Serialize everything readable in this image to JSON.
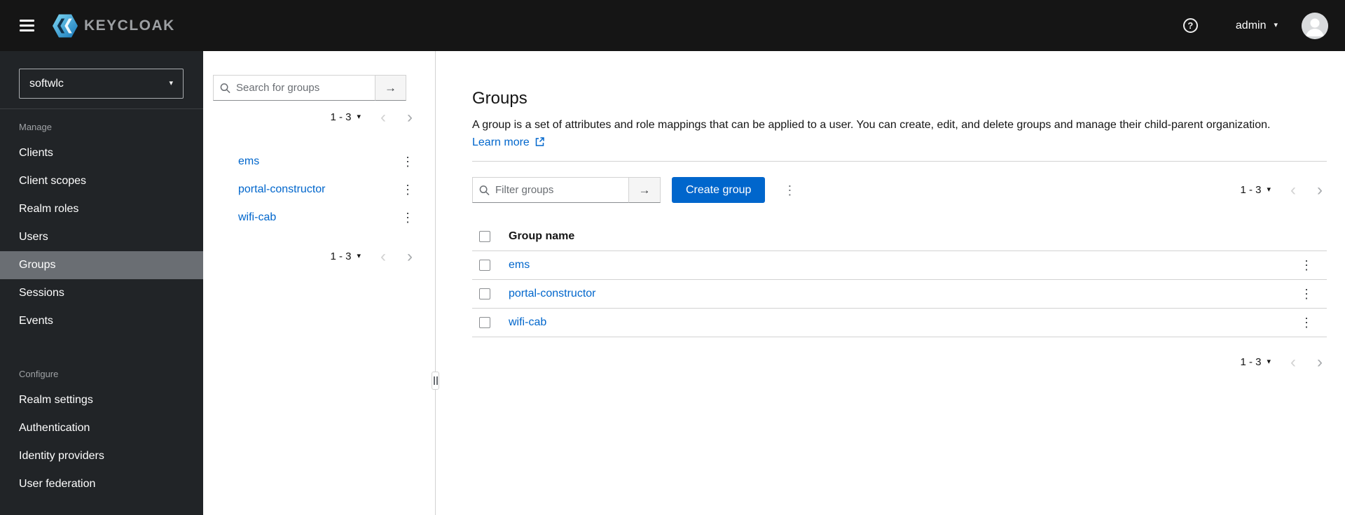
{
  "masthead": {
    "brand": "KEYCLOAK",
    "user": "admin"
  },
  "icons": {
    "help": "?",
    "caret_down": "▾",
    "arrow_right": "→",
    "kebab": "⋮",
    "chevron_left": "‹",
    "chevron_right": "›"
  },
  "sidebar": {
    "realm": "softwlc",
    "sections": [
      {
        "label": "Manage",
        "items": [
          {
            "label": "Clients"
          },
          {
            "label": "Client scopes"
          },
          {
            "label": "Realm roles"
          },
          {
            "label": "Users"
          },
          {
            "label": "Groups",
            "active": true
          },
          {
            "label": "Sessions"
          },
          {
            "label": "Events"
          }
        ]
      },
      {
        "label": "Configure",
        "items": [
          {
            "label": "Realm settings"
          },
          {
            "label": "Authentication"
          },
          {
            "label": "Identity providers"
          },
          {
            "label": "User federation"
          }
        ]
      }
    ]
  },
  "drawer": {
    "search_placeholder": "Search for groups",
    "groups": [
      "ems",
      "portal-constructor",
      "wifi-cab"
    ]
  },
  "pagination": {
    "range": "1 - 3"
  },
  "main": {
    "title": "Groups",
    "description": "A group is a set of attributes and role mappings that can be applied to a user. You can create, edit, and delete groups and manage their child-parent organization.",
    "learn_more": "Learn more",
    "filter_placeholder": "Filter groups",
    "create_label": "Create group",
    "table": {
      "header": "Group name",
      "rows": [
        "ems",
        "portal-constructor",
        "wifi-cab"
      ]
    }
  },
  "colors": {
    "primary": "#0066cc",
    "link": "#0066cc",
    "masthead_bg": "#151515",
    "sidebar_bg": "#212427",
    "sidebar_active_bg": "#6a6e73",
    "border": "#d2d2d2",
    "text": "#151515",
    "muted": "#6a6e73"
  }
}
